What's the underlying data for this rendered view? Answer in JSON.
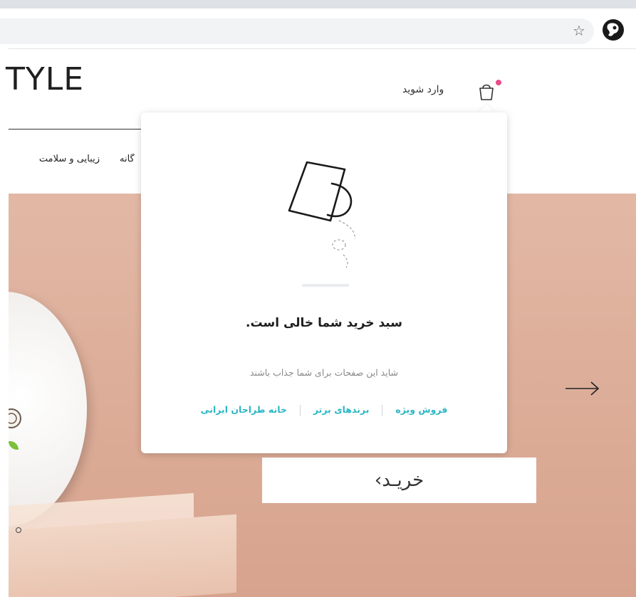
{
  "site": {
    "logo_text": "TYLE",
    "login_label": "وارد شوید",
    "nav": {
      "beauty": "زیبایی و سلامت",
      "home_partial": "گانه"
    }
  },
  "hero": {
    "buy_label": "خریـد›"
  },
  "cart_popup": {
    "title": "سبد خرید شما خالی است.",
    "subtitle": "شاید این صفحات برای شما جذاب باشند",
    "links": [
      {
        "label": "فروش ویژه"
      },
      {
        "label": "برندهای برتر"
      },
      {
        "label": "خانه طراحان ایرانی"
      }
    ]
  },
  "colors": {
    "accent_link": "#2bb6c4",
    "cart_badge": "#e84c8b",
    "hero_bg": "#dbab96"
  },
  "icons": [
    "star-icon",
    "profile-icon",
    "cart-icon",
    "empty-bag-illustration",
    "arrow-right-icon"
  ]
}
